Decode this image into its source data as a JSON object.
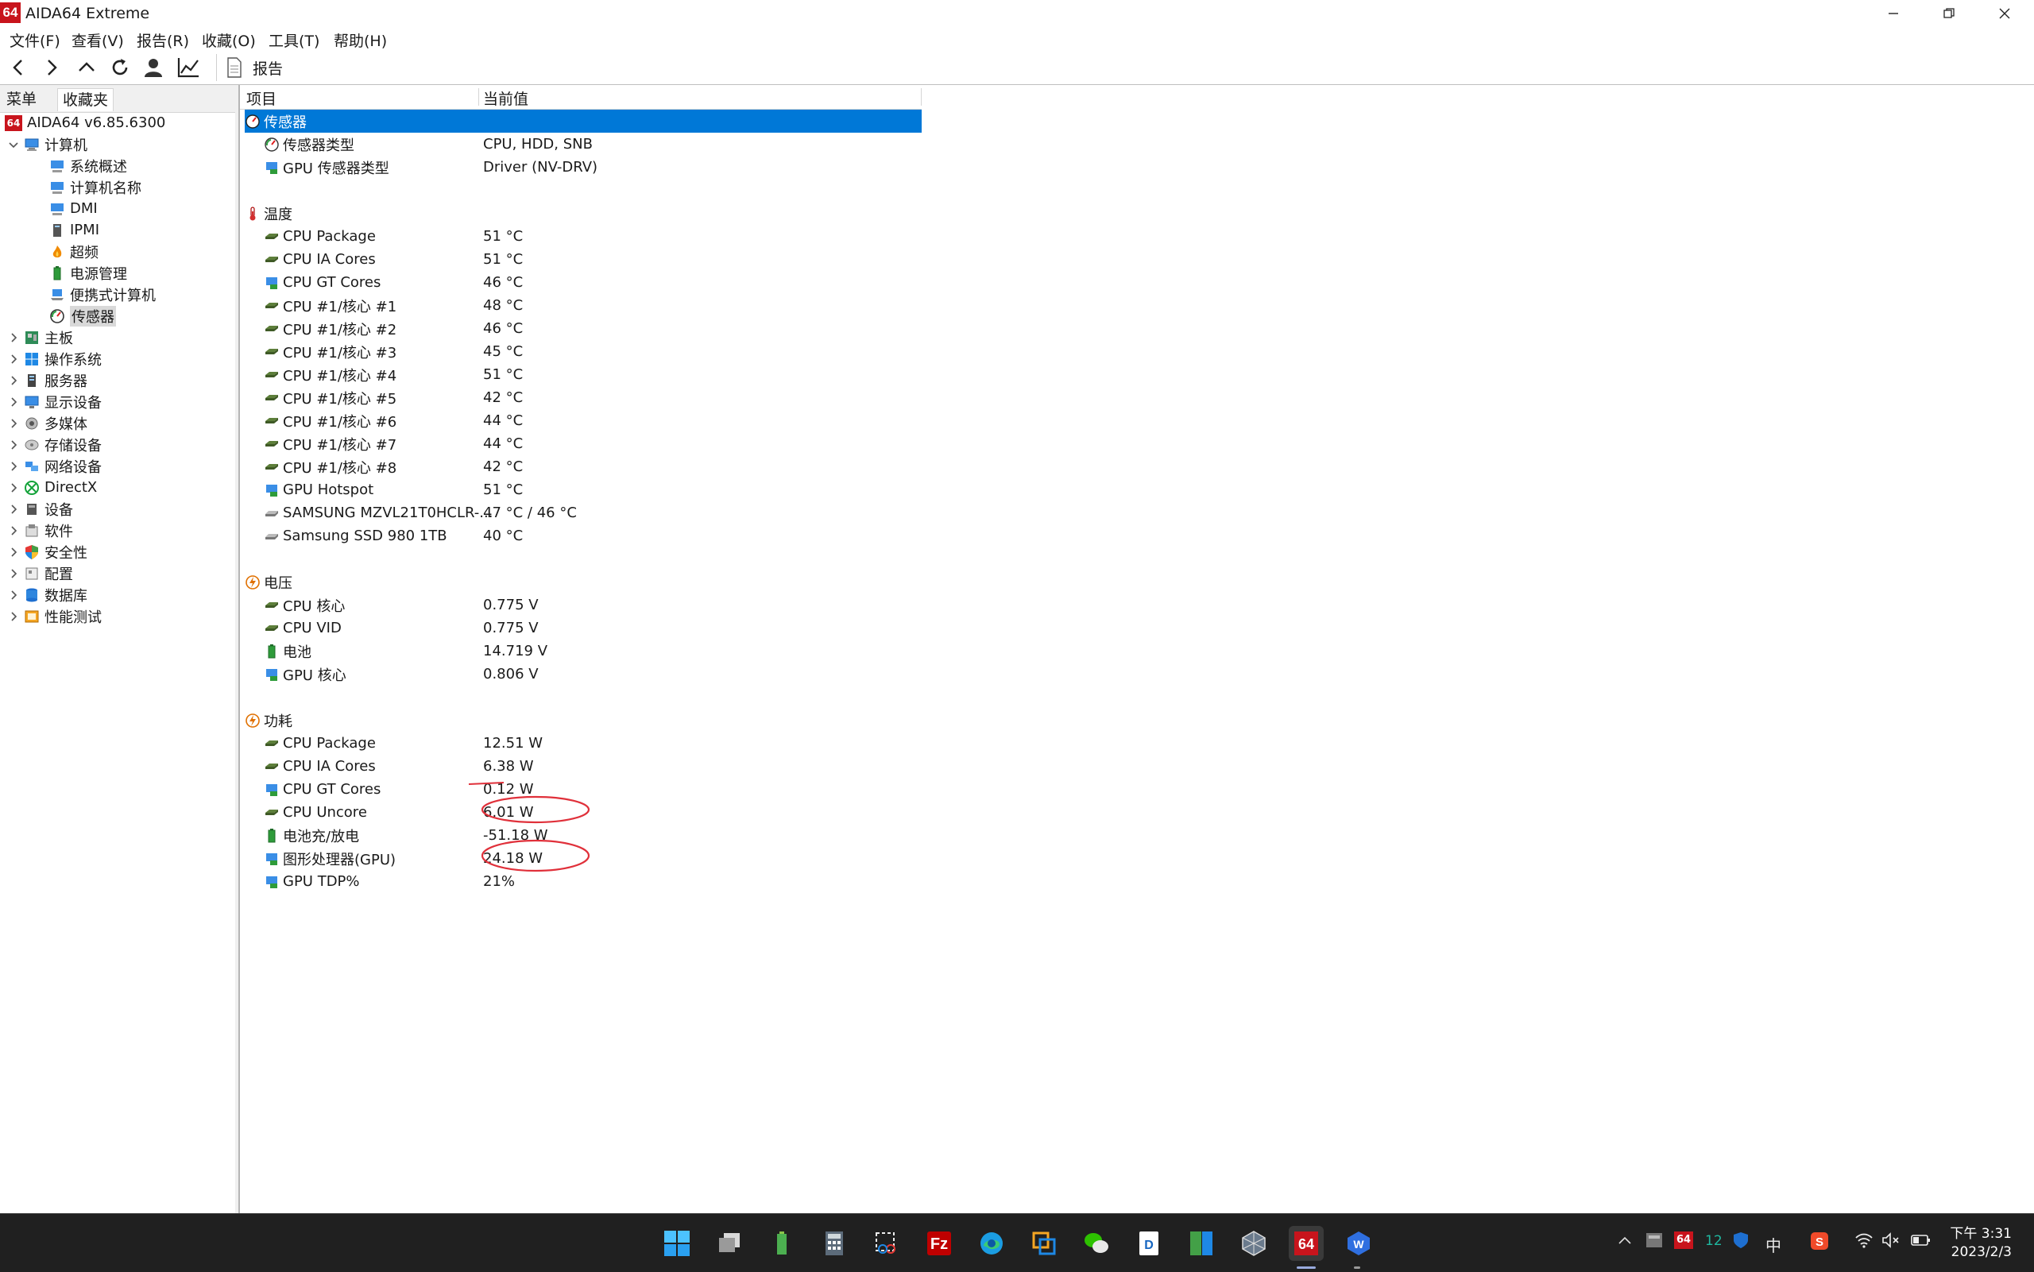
{
  "window": {
    "title": "AIDA64 Extreme",
    "logo_text": "64"
  },
  "menu": [
    "文件(F)",
    "查看(V)",
    "报告(R)",
    "收藏(O)",
    "工具(T)",
    "帮助(H)"
  ],
  "toolbar": {
    "report_label": "报告"
  },
  "left_tabs": [
    "菜单",
    "收藏夹"
  ],
  "tree": {
    "root": "AIDA64 v6.85.6300",
    "computer": "计算机",
    "computer_children": [
      "系统概述",
      "计算机名称",
      "DMI",
      "IPMI",
      "超频",
      "电源管理",
      "便携式计算机",
      "传感器"
    ],
    "top_items": [
      "主板",
      "操作系统",
      "服务器",
      "显示设备",
      "多媒体",
      "存储设备",
      "网络设备",
      "DirectX",
      "设备",
      "软件",
      "安全性",
      "配置",
      "数据库",
      "性能测试"
    ]
  },
  "columns": {
    "item": "项目",
    "value": "当前值"
  },
  "sections": {
    "sensor": {
      "title": "传感器",
      "rows": [
        {
          "name": "传感器类型",
          "value": "CPU, HDD, SNB"
        },
        {
          "name": "GPU 传感器类型",
          "value": "Driver  (NV-DRV)"
        }
      ]
    },
    "temperature": {
      "title": "温度",
      "rows": [
        {
          "name": "CPU Package",
          "value": "51 °C"
        },
        {
          "name": "CPU IA Cores",
          "value": "51 °C"
        },
        {
          "name": "CPU GT Cores",
          "value": "46 °C"
        },
        {
          "name": "CPU #1/核心 #1",
          "value": "48 °C"
        },
        {
          "name": "CPU #1/核心 #2",
          "value": "46 °C"
        },
        {
          "name": "CPU #1/核心 #3",
          "value": "45 °C"
        },
        {
          "name": "CPU #1/核心 #4",
          "value": "51 °C"
        },
        {
          "name": "CPU #1/核心 #5",
          "value": "42 °C"
        },
        {
          "name": "CPU #1/核心 #6",
          "value": "44 °C"
        },
        {
          "name": "CPU #1/核心 #7",
          "value": "44 °C"
        },
        {
          "name": "CPU #1/核心 #8",
          "value": "42 °C"
        },
        {
          "name": "GPU Hotspot",
          "value": "51 °C"
        },
        {
          "name": "SAMSUNG MZVL21T0HCLR-...",
          "value": "47 °C / 46 °C"
        },
        {
          "name": "Samsung SSD 980 1TB",
          "value": "40 °C"
        }
      ]
    },
    "voltage": {
      "title": "电压",
      "rows": [
        {
          "name": "CPU 核心",
          "value": "0.775 V"
        },
        {
          "name": "CPU VID",
          "value": "0.775 V"
        },
        {
          "name": "电池",
          "value": "14.719 V"
        },
        {
          "name": "GPU 核心",
          "value": "0.806 V"
        }
      ]
    },
    "power": {
      "title": "功耗",
      "rows": [
        {
          "name": "CPU Package",
          "value": "12.51 W"
        },
        {
          "name": "CPU IA Cores",
          "value": "6.38 W"
        },
        {
          "name": "CPU GT Cores",
          "value": "0.12 W"
        },
        {
          "name": "CPU Uncore",
          "value": "6.01 W"
        },
        {
          "name": "电池充/放电",
          "value": "-51.18 W"
        },
        {
          "name": "图形处理器(GPU)",
          "value": "24.18 W"
        },
        {
          "name": "GPU TDP%",
          "value": "21%"
        }
      ]
    }
  },
  "taskbar": {
    "tray_badge_text": "64",
    "tray_number": "12",
    "ime": "中",
    "time": "下午 3:31",
    "date": "2023/2/3"
  },
  "colors": {
    "selection": "#0078d7",
    "annotation": "#e0303a",
    "brand": "#c8141c"
  }
}
